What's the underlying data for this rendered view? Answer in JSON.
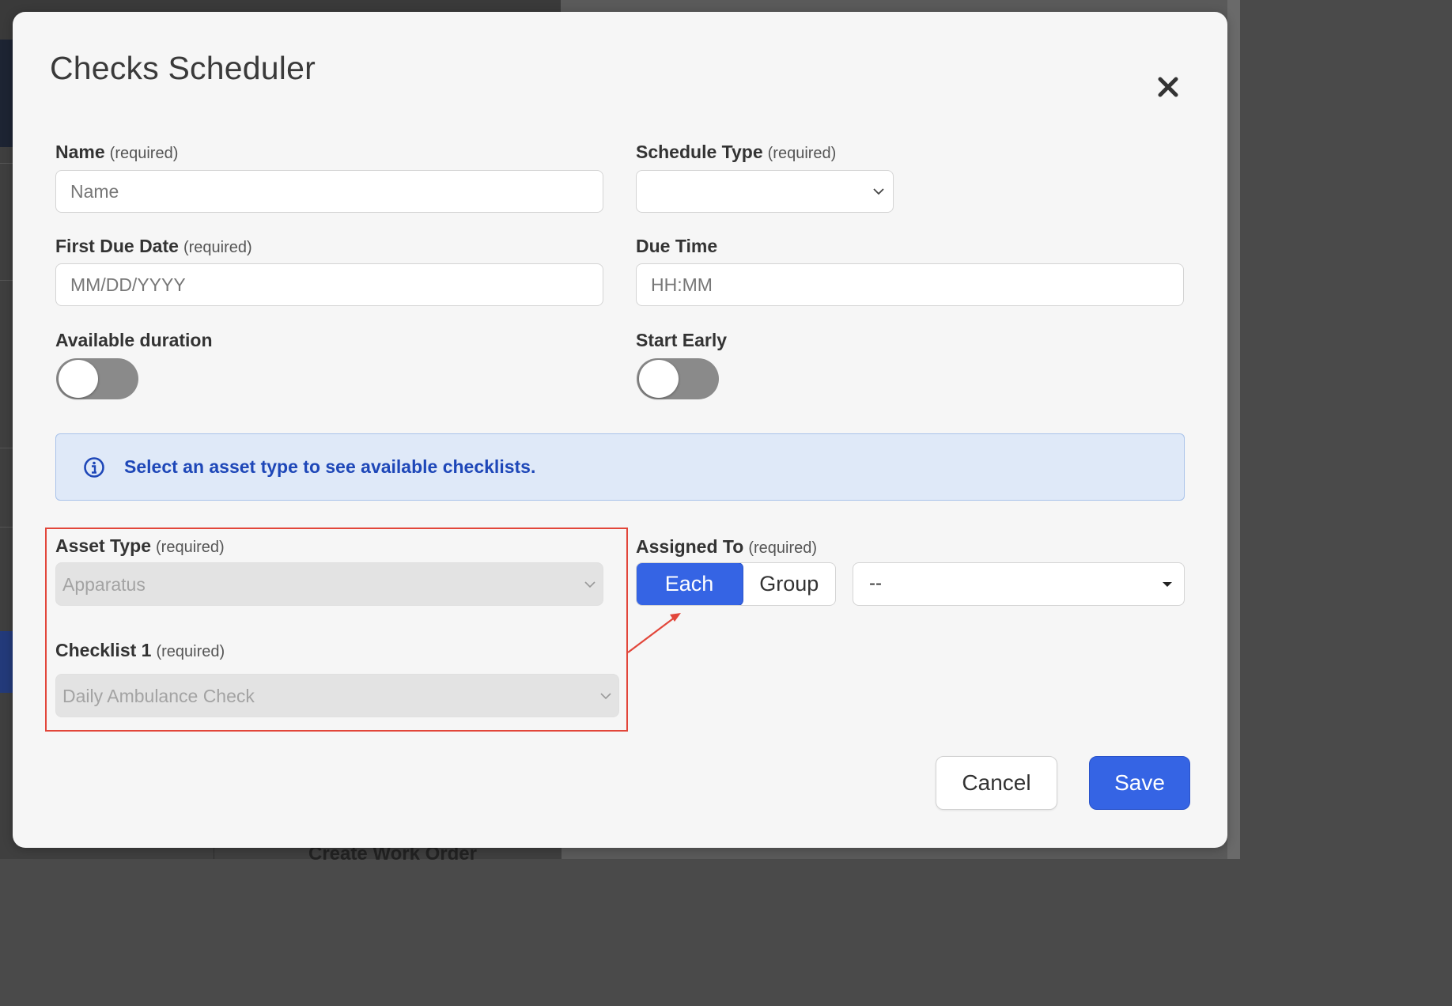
{
  "background": {
    "bottom_text": "Create Work Order"
  },
  "modal": {
    "title": "Checks Scheduler",
    "close_icon": "close-icon"
  },
  "form": {
    "name": {
      "label": "Name",
      "required": "(required)",
      "placeholder": "Name",
      "value": ""
    },
    "schedule_type": {
      "label": "Schedule Type",
      "required": "(required)",
      "value": ""
    },
    "first_due_date": {
      "label": "First Due Date",
      "required": "(required)",
      "placeholder": "MM/DD/YYYY",
      "value": ""
    },
    "due_time": {
      "label": "Due Time",
      "placeholder": "HH:MM",
      "value": ""
    },
    "available_duration": {
      "label": "Available duration",
      "on": false
    },
    "start_early": {
      "label": "Start Early",
      "on": false
    },
    "info_banner": {
      "icon": "info-icon",
      "text": "Select an asset type to see available checklists."
    },
    "asset_type": {
      "label": "Asset Type",
      "required": "(required)",
      "value": "Apparatus",
      "disabled": true
    },
    "checklist_1": {
      "label": "Checklist 1",
      "required": "(required)",
      "value": "Daily Ambulance Check",
      "disabled": true
    },
    "assigned_to": {
      "label": "Assigned To",
      "required": "(required)",
      "options": [
        "Each",
        "Group"
      ],
      "selected": "Each",
      "assignee_value": "--"
    }
  },
  "footer": {
    "cancel_label": "Cancel",
    "save_label": "Save"
  },
  "colors": {
    "primary": "#3564e4",
    "info_bg": "#dfe9f8",
    "info_text": "#1e47b8",
    "annotation": "#e2463a"
  }
}
